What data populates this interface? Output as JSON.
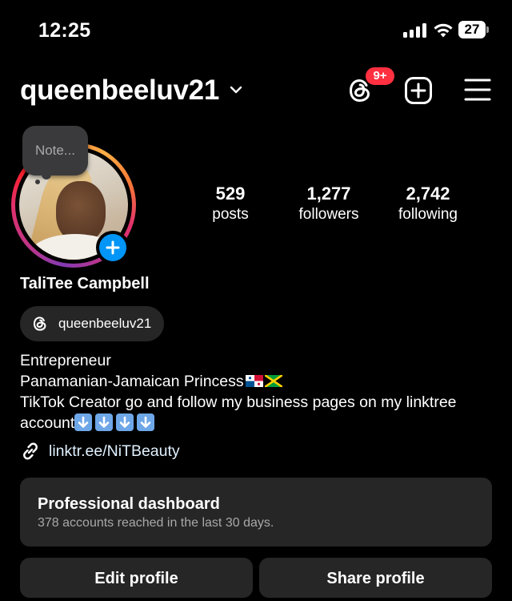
{
  "status_bar": {
    "time": "12:25",
    "battery_level": "27",
    "icons": [
      "signal-icon",
      "wifi-icon",
      "battery-icon"
    ]
  },
  "header": {
    "username": "queenbeeluv21",
    "threads_badge": "9+",
    "icons": [
      "chevron-down-icon",
      "threads-icon",
      "create-post-icon",
      "menu-icon"
    ],
    "badge_color": "#ff3040"
  },
  "profile": {
    "note_placeholder": "Note...",
    "stats": [
      {
        "value": "529",
        "label": "posts"
      },
      {
        "value": "1,277",
        "label": "followers"
      },
      {
        "value": "2,742",
        "label": "following"
      }
    ],
    "display_name": "TaliTee Campbell",
    "threads_handle": "queenbeeluv21",
    "bio": {
      "line1": "Entrepreneur",
      "line2": "Panamanian-Jamaican Princess",
      "line3": "TikTok Creator go and follow my business pages on my linktree",
      "line4": "account",
      "flags": [
        "panama-flag",
        "jamaica-flag"
      ],
      "down_arrow_count": 4
    },
    "link": "linktr.ee/NiTBeauty"
  },
  "dashboard": {
    "title": "Professional dashboard",
    "subtitle": "378 accounts reached in the last 30 days."
  },
  "actions": {
    "edit_label": "Edit profile",
    "share_label": "Share profile"
  },
  "colors": {
    "background": "#000000",
    "card": "#262626",
    "accent_blue": "#0095f6",
    "secondary_text": "#a8a8a8"
  }
}
